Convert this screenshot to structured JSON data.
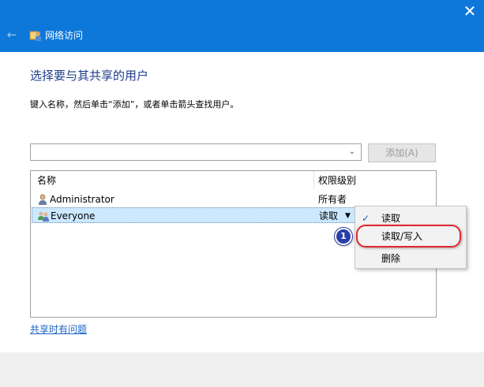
{
  "window": {
    "title": "网络访问",
    "close_symbol": "✕",
    "back_symbol": "←"
  },
  "main": {
    "heading": "选择要与其共享的用户",
    "hint": "键入名称，然后单击“添加”，或者单击箭头查找用户。",
    "name_input": {
      "value": "",
      "placeholder": ""
    },
    "add_button": "添加(A)"
  },
  "list": {
    "columns": [
      "名称",
      "权限级别"
    ],
    "rows": [
      {
        "name": "Administrator",
        "permission": "所有者",
        "selected": false
      },
      {
        "name": "Everyone",
        "permission": "读取",
        "selected": true
      }
    ]
  },
  "menu": {
    "items": [
      {
        "label": "读取",
        "checked": true
      },
      {
        "label": "读取/写入",
        "checked": false
      },
      {
        "label": "删除",
        "checked": false
      }
    ],
    "highlighted_item": "读取/写入"
  },
  "annotation": {
    "step": "1"
  },
  "footer": {
    "link": "共享时有问题"
  },
  "colors": {
    "titlebar": "#0d78d9",
    "accent": "#1b64c5",
    "selection": "#cce8ff",
    "highlight_ring": "#e0282c",
    "step_badge": "#2a3ea8"
  },
  "icons": [
    "back-arrow-icon",
    "network-share-icon",
    "close-icon",
    "chevron-down-icon",
    "user-icon",
    "group-icon",
    "checkmark-icon",
    "dropdown-caret-icon"
  ]
}
